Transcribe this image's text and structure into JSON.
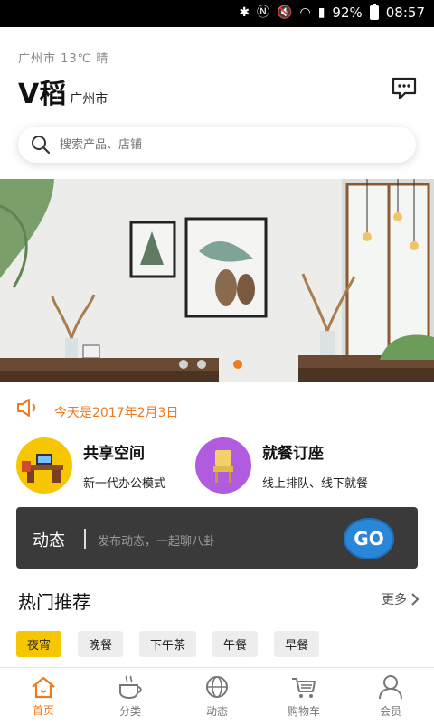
{
  "status_bar": {
    "battery": "92%",
    "time": "08:57"
  },
  "header": {
    "weather": "广州市  13℃  晴",
    "brand": "V稻",
    "city": "广州市"
  },
  "search": {
    "placeholder": "搜索产品、店铺"
  },
  "banner": {
    "dots": 4,
    "active_dot": 4
  },
  "notice": {
    "text": "今天是2017年2月3日"
  },
  "features": [
    {
      "title": "共享空间",
      "subtitle": "新一代办公模式",
      "icon": "office-desk-icon",
      "color": "#f6c600"
    },
    {
      "title": "就餐订座",
      "subtitle": "线上排队、线下就餐",
      "icon": "chair-icon",
      "color": "#b15bdf"
    }
  ],
  "feed": {
    "label": "动态",
    "placeholder": "发布动态，一起聊八卦",
    "go_label": "GO"
  },
  "hot": {
    "title": "热门推荐",
    "more": "更多",
    "tags": [
      "夜宵",
      "晚餐",
      "下午茶",
      "午餐",
      "早餐"
    ],
    "active_tag": "夜宵"
  },
  "tabbar": [
    {
      "label": "首页",
      "icon": "home-icon",
      "active": true
    },
    {
      "label": "分类",
      "icon": "coffee-cup-icon",
      "active": false
    },
    {
      "label": "动态",
      "icon": "globe-icon",
      "active": false
    },
    {
      "label": "购物车",
      "icon": "cart-icon",
      "active": false
    },
    {
      "label": "会员",
      "icon": "user-icon",
      "active": false
    }
  ],
  "colors": {
    "accent": "#f07a1f",
    "tag_active": "#f6c600",
    "feed_bg": "#3a3a3a"
  }
}
